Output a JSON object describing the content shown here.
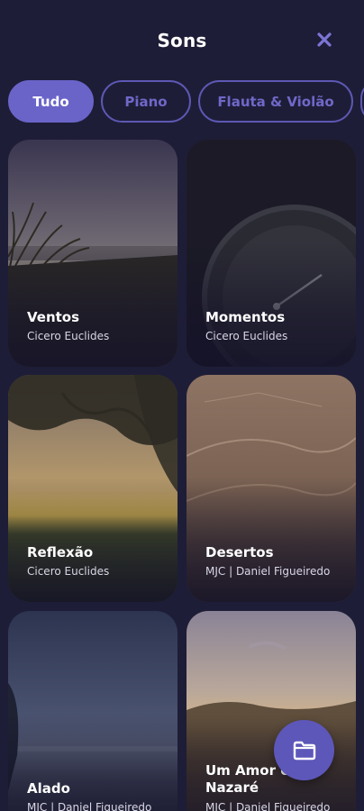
{
  "header": {
    "title": "Sons"
  },
  "filters": [
    {
      "label": "Tudo",
      "active": true
    },
    {
      "label": "Piano",
      "active": false
    },
    {
      "label": "Flauta & Violão",
      "active": false
    }
  ],
  "cards": [
    {
      "title": "Ventos",
      "subtitle": "Cicero Euclides"
    },
    {
      "title": "Momentos",
      "subtitle": "Cicero Euclides"
    },
    {
      "title": "Reflexão",
      "subtitle": "Cicero Euclides"
    },
    {
      "title": "Desertos",
      "subtitle": "MJC | Daniel Figueiredo"
    },
    {
      "title": "Alado",
      "subtitle": "MJC | Daniel Figueiredo"
    },
    {
      "title": "Um Amor em Nazaré",
      "subtitle": "MJC | Daniel Figueiredo"
    }
  ],
  "icons": {
    "close": "close-icon",
    "fab": "folder-icon"
  },
  "colors": {
    "background": "#1e1d37",
    "accent": "#6a64c9",
    "chip_border": "#5d58b4",
    "fab": "#5d57ba"
  }
}
